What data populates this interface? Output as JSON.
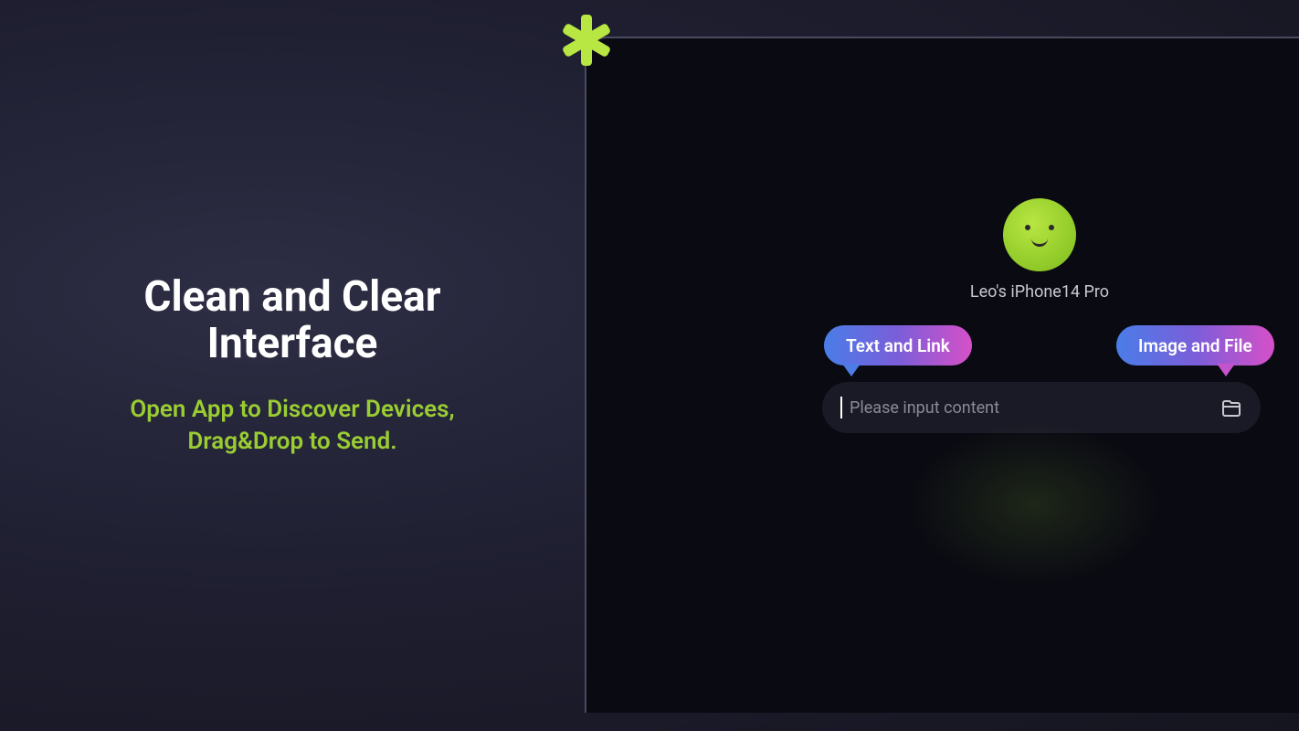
{
  "marketing": {
    "headline": "Clean and Clear Interface",
    "subheadline": "Open App to Discover Devices, Drag&Drop to Send."
  },
  "device": {
    "name": "Leo's iPhone14 Pro"
  },
  "actions": {
    "text_link_label": "Text and Link",
    "image_file_label": "Image and File"
  },
  "input": {
    "placeholder": "Please input content"
  }
}
